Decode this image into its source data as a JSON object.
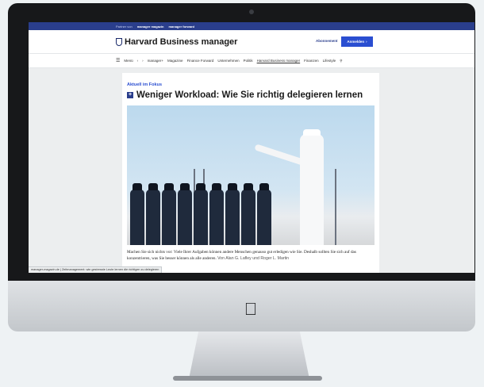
{
  "topbar": {
    "items": [
      "Partner von",
      "manager magazin",
      "manager forward"
    ]
  },
  "header": {
    "logo_text": "Harvard Business manager",
    "subscribe_label": "Abonnement",
    "login_label": "Anmelden",
    "login_arrow": "›"
  },
  "nav": {
    "menu_label": "Menü",
    "prev_arrow": "‹",
    "next_arrow": "›",
    "items": [
      "manager+",
      "Magazine",
      "Finance Forward",
      "Unternehmen",
      "Politik",
      "Harvard Business manager",
      "Finanzen",
      "Lifestyle"
    ],
    "selected": "Harvard Business manager"
  },
  "article": {
    "kicker": "Aktuell im Fokus",
    "headline": "Weniger Workload: Wie Sie richtig delegieren lernen",
    "teaser": "Machen Sie sich nichts vor: Viele Ihrer Aufgaben können andere Menschen genauso gut erledigen wie Sie. Deshalb sollten Sie sich auf das konzentrieren, was Sie besser können als alle anderen.",
    "byline": "Von Alan G. Lafley und Roger L. Martin"
  },
  "status_bar": {
    "text": "manager-magazin.de | Zeitmanagement: wie gestresste Leute lernen die richtigen zu delegieren"
  },
  "colors": {
    "accent_blue": "#2a4ed1",
    "topbar_navy": "#2a3e8c"
  }
}
